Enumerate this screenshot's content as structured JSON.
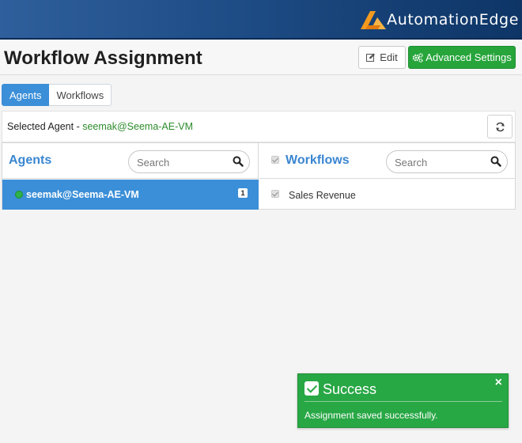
{
  "header": {
    "brand": "AutomationEdge"
  },
  "title_row": {
    "title": "Workflow Assignment",
    "edit_label": "Edit",
    "advanced_label": "Advanced Settings"
  },
  "tabs": [
    {
      "label": "Agents",
      "active": true
    },
    {
      "label": "Workflows",
      "active": false
    }
  ],
  "selected_agent": {
    "label": "Selected Agent - ",
    "value": "seemak@Seema-AE-VM"
  },
  "agents_panel": {
    "title": "Agents",
    "search_placeholder": "Search",
    "items": [
      {
        "name": "seemak@Seema-AE-VM",
        "count": "1",
        "status": "online"
      }
    ]
  },
  "workflows_panel": {
    "title": "Workflows",
    "search_placeholder": "Search",
    "items": [
      {
        "name": "Sales Revenue",
        "checked": true
      }
    ]
  },
  "toast": {
    "title": "Success",
    "message": "Assignment saved successfully.",
    "close": "×"
  },
  "colors": {
    "accent": "#3b8fd8",
    "success": "#28a745",
    "header": "#1e4c85",
    "brand_orange": "#f39a1e"
  }
}
